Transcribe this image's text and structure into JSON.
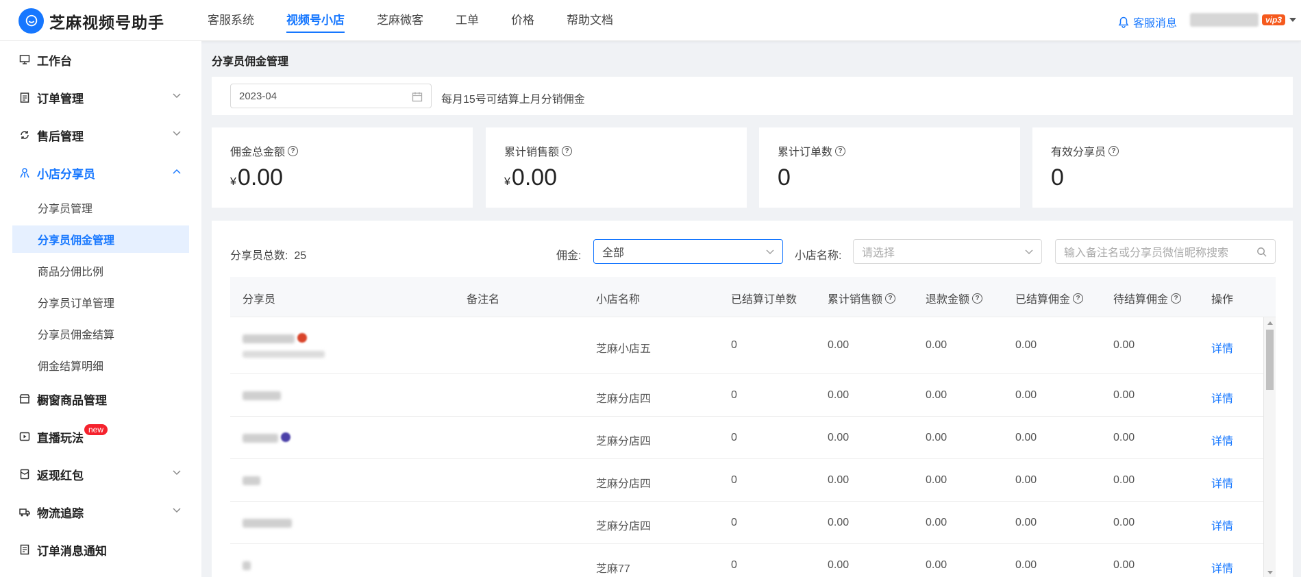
{
  "app": {
    "title": "芝麻视频号助手"
  },
  "nav": [
    {
      "label": "客服系统",
      "active": false
    },
    {
      "label": "视频号小店",
      "active": true
    },
    {
      "label": "芝麻微客",
      "active": false
    },
    {
      "label": "工单",
      "active": false
    },
    {
      "label": "价格",
      "active": false
    },
    {
      "label": "帮助文档",
      "active": false
    }
  ],
  "header": {
    "service_msg": "客服消息",
    "vip_label": "vip3"
  },
  "sidebar": {
    "items": [
      {
        "label": "工作台",
        "icon": "monitor-icon"
      },
      {
        "label": "订单管理",
        "icon": "clipboard-icon"
      },
      {
        "label": "售后管理",
        "icon": "refresh-icon"
      },
      {
        "label": "小店分享员",
        "icon": "sharer-icon"
      },
      {
        "label": "橱窗商品管理",
        "icon": "shop-window-icon"
      },
      {
        "label": "直播玩法",
        "icon": "live-icon",
        "badge": "new"
      },
      {
        "label": "返现红包",
        "icon": "red-packet-icon"
      },
      {
        "label": "物流追踪",
        "icon": "truck-icon"
      },
      {
        "label": "订单消息通知",
        "icon": "notify-icon"
      }
    ],
    "sub_items": [
      {
        "label": "分享员管理"
      },
      {
        "label": "分享员佣金管理",
        "active": true
      },
      {
        "label": "商品分佣比例"
      },
      {
        "label": "分享员订单管理"
      },
      {
        "label": "分享员佣金结算"
      },
      {
        "label": "佣金结算明细"
      }
    ]
  },
  "page": {
    "title": "分享员佣金管理",
    "date_value": "2023-04",
    "hint": "每月15号可结算上月分销佣金"
  },
  "stats": [
    {
      "label": "佣金总金额",
      "currency": "¥",
      "value": "0.00"
    },
    {
      "label": "累计销售额",
      "currency": "¥",
      "value": "0.00"
    },
    {
      "label": "累计订单数",
      "currency": "",
      "value": "0"
    },
    {
      "label": "有效分享员",
      "currency": "",
      "value": "0"
    }
  ],
  "filters": {
    "total_label": "分享员总数:",
    "total_value": "25",
    "commission_label": "佣金:",
    "commission_value": "全部",
    "shop_label": "小店名称:",
    "shop_placeholder": "请选择",
    "search_placeholder": "输入备注名或分享员微信昵称搜索"
  },
  "table": {
    "headers": [
      "分享员",
      "备注名",
      "小店名称",
      "已结算订单数",
      "累计销售额",
      "退款金额",
      "已结算佣金",
      "待结算佣金",
      "操作"
    ],
    "header_help": [
      false,
      false,
      false,
      false,
      true,
      true,
      true,
      true,
      false
    ],
    "rows": [
      {
        "shop": "芝麻小店五",
        "settled_orders": "0",
        "sales": "0.00",
        "refund": "0.00",
        "settled": "0.00",
        "pending": "0.00",
        "action": "详情"
      },
      {
        "shop": "芝麻分店四",
        "settled_orders": "0",
        "sales": "0.00",
        "refund": "0.00",
        "settled": "0.00",
        "pending": "0.00",
        "action": "详情"
      },
      {
        "shop": "芝麻分店四",
        "settled_orders": "0",
        "sales": "0.00",
        "refund": "0.00",
        "settled": "0.00",
        "pending": "0.00",
        "action": "详情"
      },
      {
        "shop": "芝麻分店四",
        "settled_orders": "0",
        "sales": "0.00",
        "refund": "0.00",
        "settled": "0.00",
        "pending": "0.00",
        "action": "详情"
      },
      {
        "shop": "芝麻分店四",
        "settled_orders": "0",
        "sales": "0.00",
        "refund": "0.00",
        "settled": "0.00",
        "pending": "0.00",
        "action": "详情"
      },
      {
        "shop": "芝麻77",
        "settled_orders": "0",
        "sales": "0.00",
        "refund": "0.00",
        "settled": "0.00",
        "pending": "0.00",
        "action": "详情"
      }
    ]
  },
  "colors": {
    "accent": "#1677ff",
    "badge": "#f5222d",
    "vip": "#f55a1e"
  }
}
